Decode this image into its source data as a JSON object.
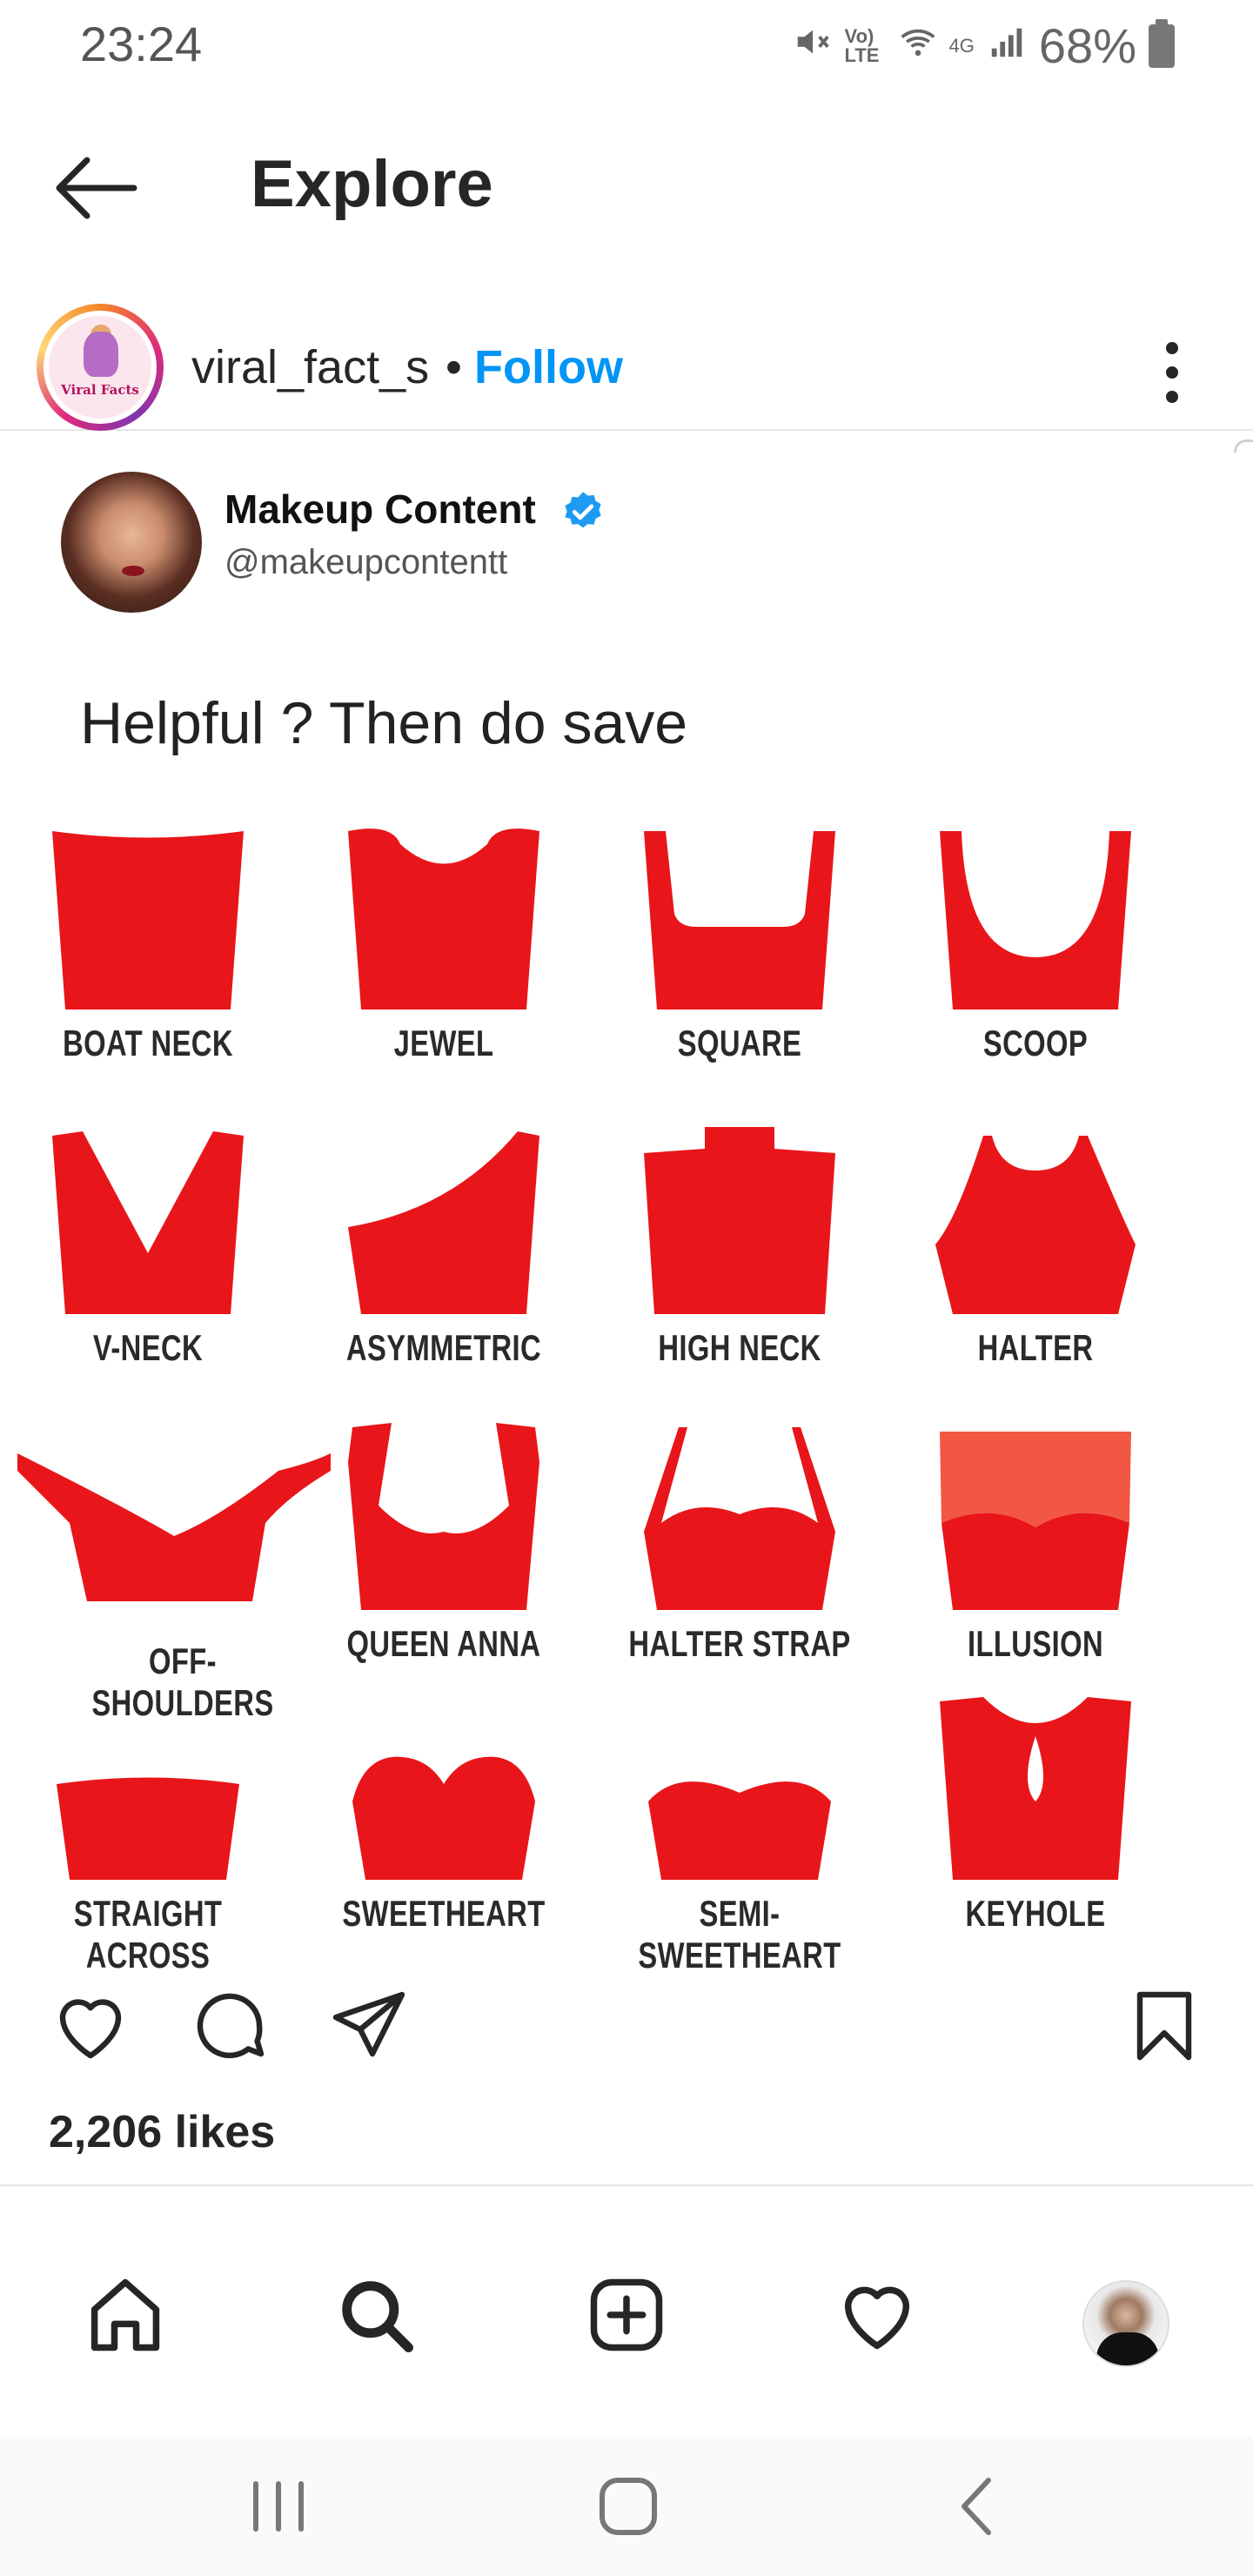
{
  "status_bar": {
    "time": "23:24",
    "network": "Vo) LTE",
    "signal_type": "4G",
    "battery_percent": "68%",
    "icons": [
      "mute-icon",
      "wifi-icon",
      "signal-icon",
      "battery-icon"
    ]
  },
  "header": {
    "title": "Explore",
    "back_icon": "arrow-left-icon"
  },
  "post": {
    "username": "viral_fact_s",
    "separator": "•",
    "follow_label": "Follow",
    "avatar_text": "Viral Facts",
    "more_icon": "more-vertical-icon"
  },
  "tweet": {
    "name": "Makeup Content",
    "handle": "@makeupcontentt",
    "text": "Helpful ? Then do save"
  },
  "necklines": [
    {
      "label": "BOAT NECK",
      "shape": "boat"
    },
    {
      "label": "JEWEL",
      "shape": "jewel"
    },
    {
      "label": "SQUARE",
      "shape": "square"
    },
    {
      "label": "SCOOP",
      "shape": "scoop"
    },
    {
      "label": "V-NECK",
      "shape": "vneck"
    },
    {
      "label": "ASYMMETRIC",
      "shape": "asym"
    },
    {
      "label": "HIGH NECK",
      "shape": "high"
    },
    {
      "label": "HALTER",
      "shape": "halter"
    },
    {
      "label": "OFF-SHOULDERS",
      "shape": "offshoulder"
    },
    {
      "label": "QUEEN ANNA",
      "shape": "queenanna"
    },
    {
      "label": "HALTER STRAP",
      "shape": "halterstrap"
    },
    {
      "label": "ILLUSION",
      "shape": "illusion"
    },
    {
      "label": "STRAIGHT ACROSS",
      "shape": "straight"
    },
    {
      "label": "SWEETHEART",
      "shape": "sweetheart"
    },
    {
      "label": "SEMI-SWEETHEART",
      "shape": "semisweet"
    },
    {
      "label": "KEYHOLE",
      "shape": "keyhole"
    }
  ],
  "neck_color": "#e8161a",
  "actions": {
    "icons": [
      "heart-icon",
      "comment-icon",
      "share-icon",
      "bookmark-icon"
    ],
    "likes": "2,206 likes"
  },
  "bottom_nav": {
    "items": [
      "home-icon",
      "search-icon",
      "add-post-icon",
      "activity-heart-icon",
      "profile-avatar"
    ]
  },
  "system_nav": {
    "items": [
      "recent-apps-icon",
      "home-button-icon",
      "back-icon"
    ]
  },
  "colors": {
    "link": "#0095f6",
    "text": "#262626",
    "divider": "#e6e6e6",
    "verified": "#1d9bf0"
  }
}
